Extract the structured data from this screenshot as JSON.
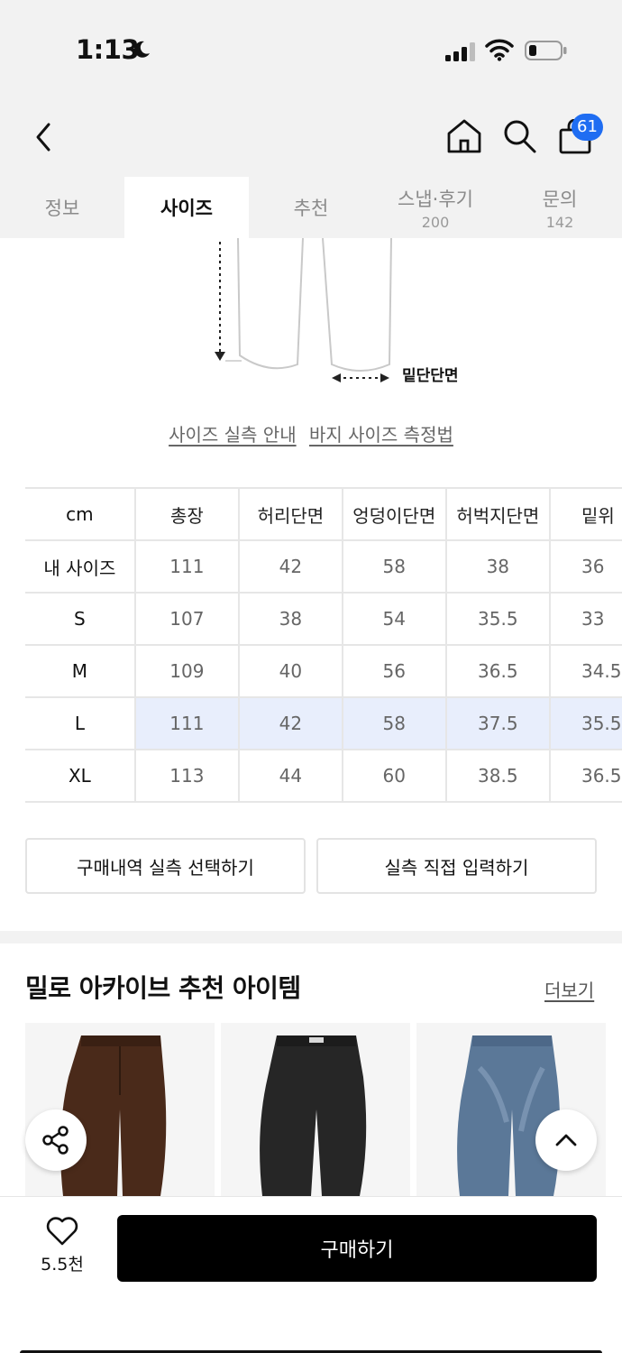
{
  "status": {
    "time": "1:13"
  },
  "header": {
    "cart_count": "61"
  },
  "tabs": [
    {
      "label": "정보",
      "count": ""
    },
    {
      "label": "사이즈",
      "count": ""
    },
    {
      "label": "추천",
      "count": ""
    },
    {
      "label": "스냅·후기",
      "count": "200"
    },
    {
      "label": "문의",
      "count": "142"
    }
  ],
  "diagram": {
    "hem_label": "밑단단면"
  },
  "links": {
    "actual_size_guide": "사이즈 실측 안내",
    "pants_measure_guide": "바지 사이즈 측정법"
  },
  "size_table": {
    "unit": "cm",
    "columns": [
      "총장",
      "허리단면",
      "엉덩이단면",
      "허벅지단면",
      "밑위"
    ],
    "rows": [
      {
        "label": "내 사이즈",
        "values": [
          "111",
          "42",
          "58",
          "38",
          "36"
        ]
      },
      {
        "label": "S",
        "values": [
          "107",
          "38",
          "54",
          "35.5",
          "33"
        ]
      },
      {
        "label": "M",
        "values": [
          "109",
          "40",
          "56",
          "36.5",
          "34.5"
        ]
      },
      {
        "label": "L",
        "values": [
          "111",
          "42",
          "58",
          "37.5",
          "35.5"
        ],
        "highlighted": true
      },
      {
        "label": "XL",
        "values": [
          "113",
          "44",
          "60",
          "38.5",
          "36.5"
        ]
      }
    ]
  },
  "buttons": {
    "select_from_purchases": "구매내역 실측 선택하기",
    "enter_directly": "실측 직접 입력하기"
  },
  "recommend": {
    "title": "밀로 아카이브 추천 아이템",
    "more": "더보기"
  },
  "bottom": {
    "like_count": "5.5천",
    "buy_label": "구매하기"
  },
  "colors": {
    "accent": "#1f6df2",
    "highlight_row": "#e8eefc",
    "buy_button": "#000000"
  }
}
